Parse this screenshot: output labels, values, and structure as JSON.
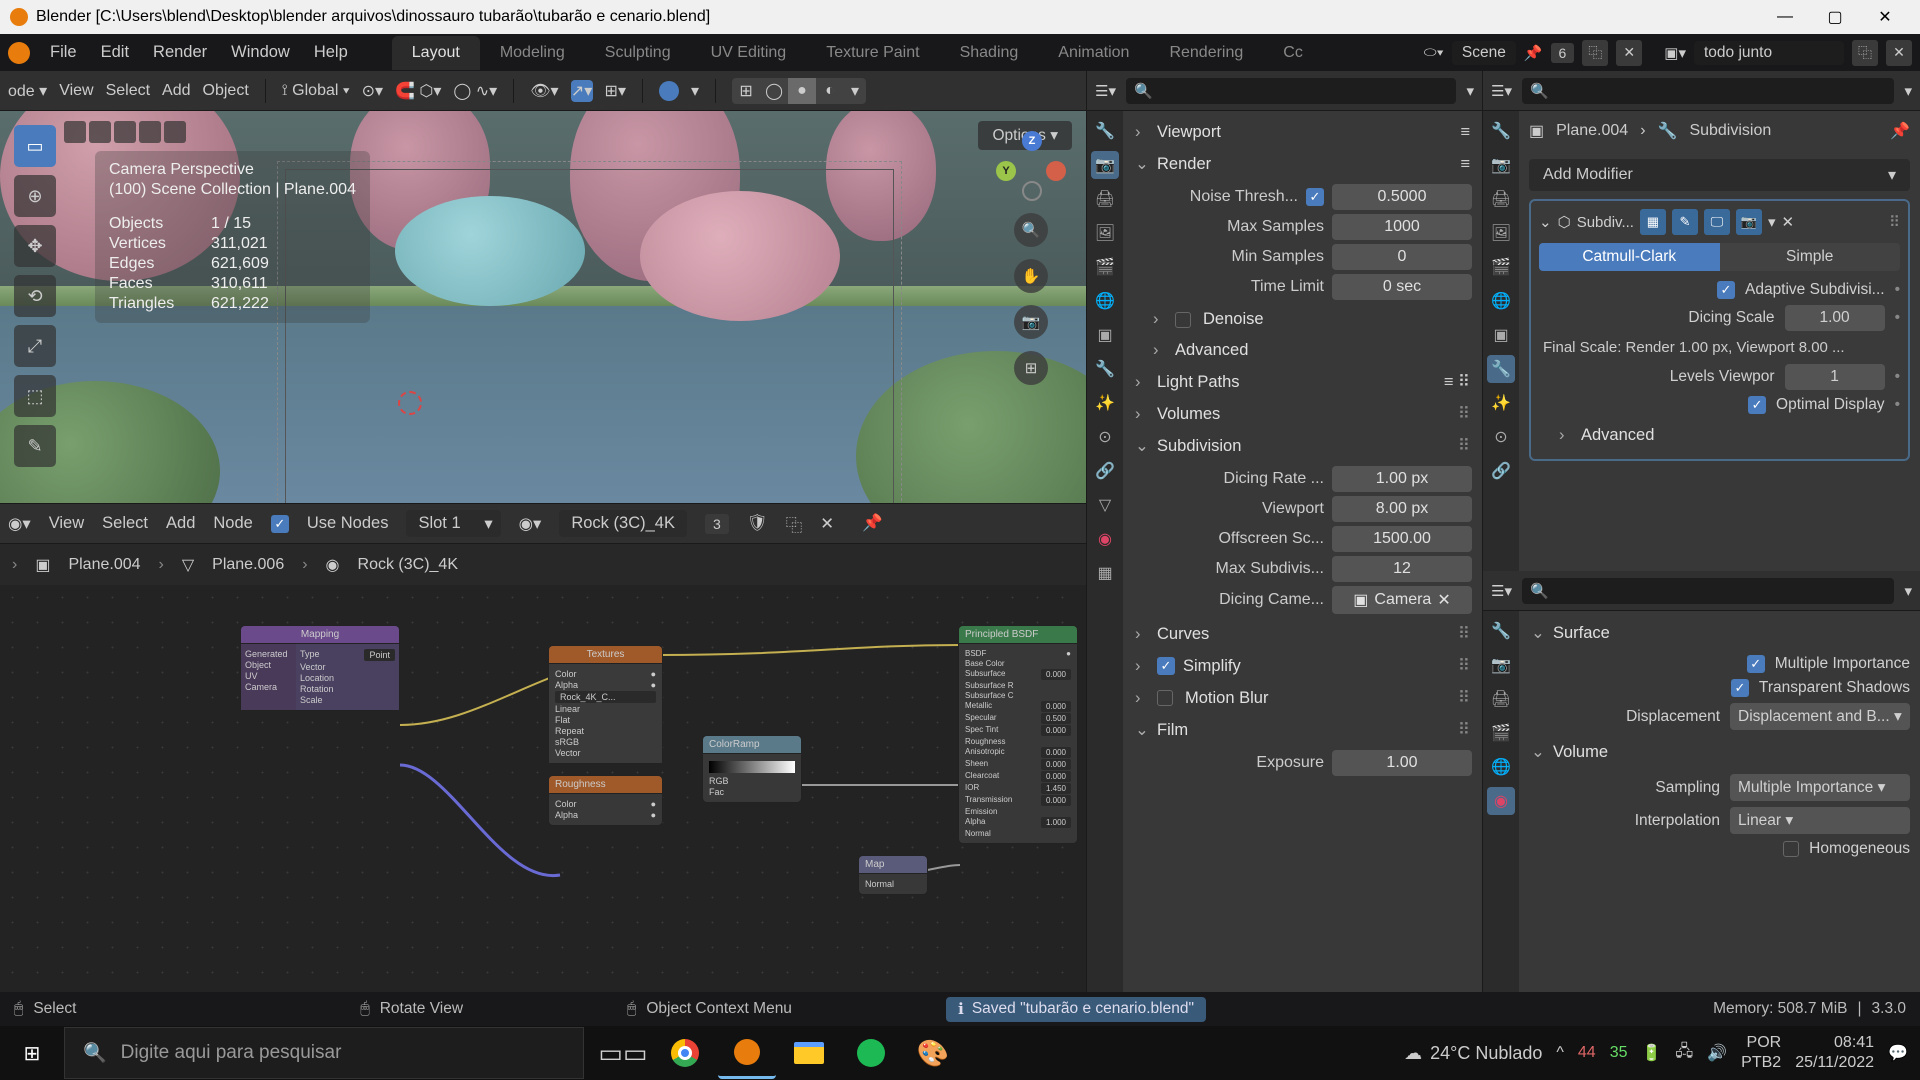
{
  "titlebar": {
    "app": "Blender",
    "path": "[C:\\Users\\blend\\Desktop\\blender arquivos\\dinossauro tubarão\\tubarão e cenario.blend]"
  },
  "menu": {
    "items": [
      "File",
      "Edit",
      "Render",
      "Window",
      "Help"
    ]
  },
  "workspaces": [
    "Layout",
    "Modeling",
    "Sculpting",
    "UV Editing",
    "Texture Paint",
    "Shading",
    "Animation",
    "Rendering",
    "Cc"
  ],
  "topright": {
    "scene_label": "Scene",
    "count": "6",
    "layer_label": "todo junto"
  },
  "viewport_toolbar": {
    "mode": "ode",
    "view": "View",
    "select": "Select",
    "add": "Add",
    "object": "Object",
    "orient": "Global",
    "options": "Options"
  },
  "viewport_info": {
    "title": "Camera Perspective",
    "subtitle": "(100) Scene Collection | Plane.004",
    "stats": [
      {
        "k": "Objects",
        "v": "1 / 15"
      },
      {
        "k": "Vertices",
        "v": "311,021"
      },
      {
        "k": "Edges",
        "v": "621,609"
      },
      {
        "k": "Faces",
        "v": "310,611"
      },
      {
        "k": "Triangles",
        "v": "621,222"
      }
    ]
  },
  "node_toolbar": {
    "view": "View",
    "select": "Select",
    "add": "Add",
    "node": "Node",
    "use_nodes": "Use Nodes",
    "slot": "Slot 1",
    "material": "Rock (3C)_4K",
    "users": "3"
  },
  "node_breadcrumb": [
    "Plane.004",
    "Plane.006",
    "Rock (3C)_4K"
  ],
  "nodes": {
    "mapping_group": "Mapping",
    "textures_group": "Textures"
  },
  "render_panel": {
    "viewport_header": "Viewport",
    "render_header": "Render",
    "noise_threshold_label": "Noise Thresh...",
    "noise_threshold": "0.5000",
    "max_samples_label": "Max Samples",
    "max_samples": "1000",
    "min_samples_label": "Min Samples",
    "min_samples": "0",
    "time_limit_label": "Time Limit",
    "time_limit": "0 sec",
    "denoise": "Denoise",
    "advanced": "Advanced",
    "light_paths": "Light Paths",
    "volumes": "Volumes",
    "subdivision": "Subdivision",
    "dicing_rate_label": "Dicing Rate ...",
    "dicing_rate": "1.00 px",
    "viewport_dice_label": "Viewport",
    "viewport_dice": "8.00 px",
    "offscreen_label": "Offscreen Sc...",
    "offscreen": "1500.00",
    "max_subdiv_label": "Max Subdivis...",
    "max_subdiv": "12",
    "dicing_cam_label": "Dicing Came...",
    "dicing_cam": "Camera",
    "curves": "Curves",
    "simplify": "Simplify",
    "motion_blur": "Motion Blur",
    "film": "Film",
    "exposure_label": "Exposure",
    "exposure": "1.00"
  },
  "modifier_panel": {
    "breadcrumb_obj": "Plane.004",
    "breadcrumb_mod": "Subdivision",
    "add_modifier": "Add Modifier",
    "mod_name": "Subdiv...",
    "tab_catmull": "Catmull-Clark",
    "tab_simple": "Simple",
    "adaptive": "Adaptive Subdivisi...",
    "dicing_scale_label": "Dicing Scale",
    "dicing_scale": "1.00",
    "final_scale": "Final Scale: Render 1.00 px, Viewport 8.00 ...",
    "levels_viewport_label": "Levels Viewpor",
    "levels_viewport": "1",
    "optimal_display": "Optimal Display",
    "advanced": "Advanced"
  },
  "material_panel": {
    "surface": "Surface",
    "mult_importance": "Multiple Importance",
    "transp_shadows": "Transparent Shadows",
    "displacement_label": "Displacement",
    "displacement_value": "Displacement and B...",
    "volume": "Volume",
    "sampling_label": "Sampling",
    "sampling_value": "Multiple Importance",
    "interpolation_label": "Interpolation",
    "interpolation_value": "Linear",
    "homogeneous": "Homogeneous"
  },
  "statusbar": {
    "select": "Select",
    "rotate": "Rotate View",
    "context": "Object Context Menu",
    "saved": "Saved \"tubarão e cenario.blend\"",
    "memory": "Memory: 508.7 MiB",
    "version": "3.3.0"
  },
  "taskbar": {
    "search_placeholder": "Digite aqui para pesquisar",
    "weather": "24°C  Nublado",
    "cpu1": "44",
    "cpu2": "35",
    "lang": "POR",
    "kbd": "PTB2",
    "time": "08:41",
    "date": "25/11/2022"
  }
}
